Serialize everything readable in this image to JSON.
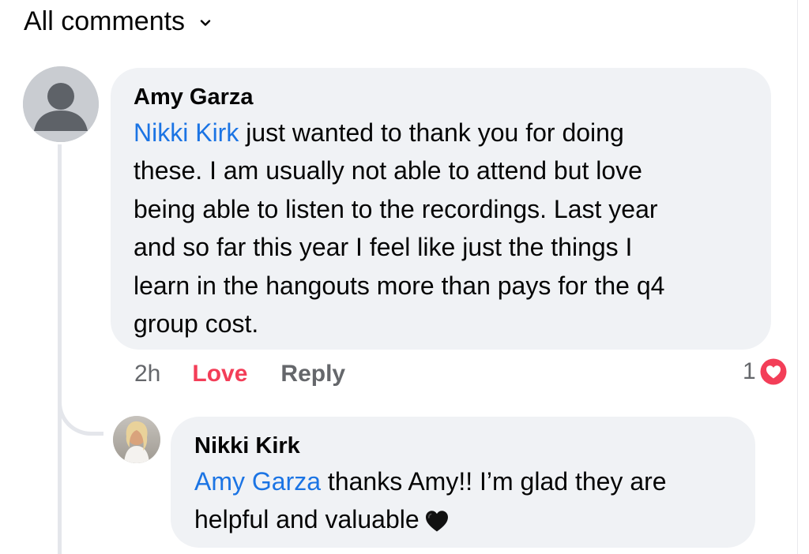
{
  "header": {
    "title": "All comments",
    "icon": "chevron-down-icon"
  },
  "comment": {
    "author": "Amy Garza",
    "mention": "Nikki Kirk",
    "text_lines": [
      " just wanted to thank you for doing",
      "these.  I am usually not able to attend but love",
      "being able to listen to the recordings.  Last year",
      "and so far this year I feel like just the things I",
      "learn in the hangouts more than pays for the q4",
      "group cost."
    ],
    "time": "2h",
    "reaction_label": "Love",
    "reply_label": "Reply",
    "reaction_count": "1",
    "reaction_icon": "love-reaction-icon",
    "avatar_icon": "default-profile-icon"
  },
  "reply": {
    "author": "Nikki Kirk",
    "mention": "Amy Garza",
    "text_lines": [
      " thanks Amy!! I’m glad they are",
      "helpful and valuable"
    ],
    "emoji": "black-heart-emoji"
  },
  "colors": {
    "bubble": "#f0f2f5",
    "mention": "#1b74e4",
    "love": "#f33e58",
    "secondary_text": "#65676b",
    "thread_line": "#e4e6eb"
  }
}
